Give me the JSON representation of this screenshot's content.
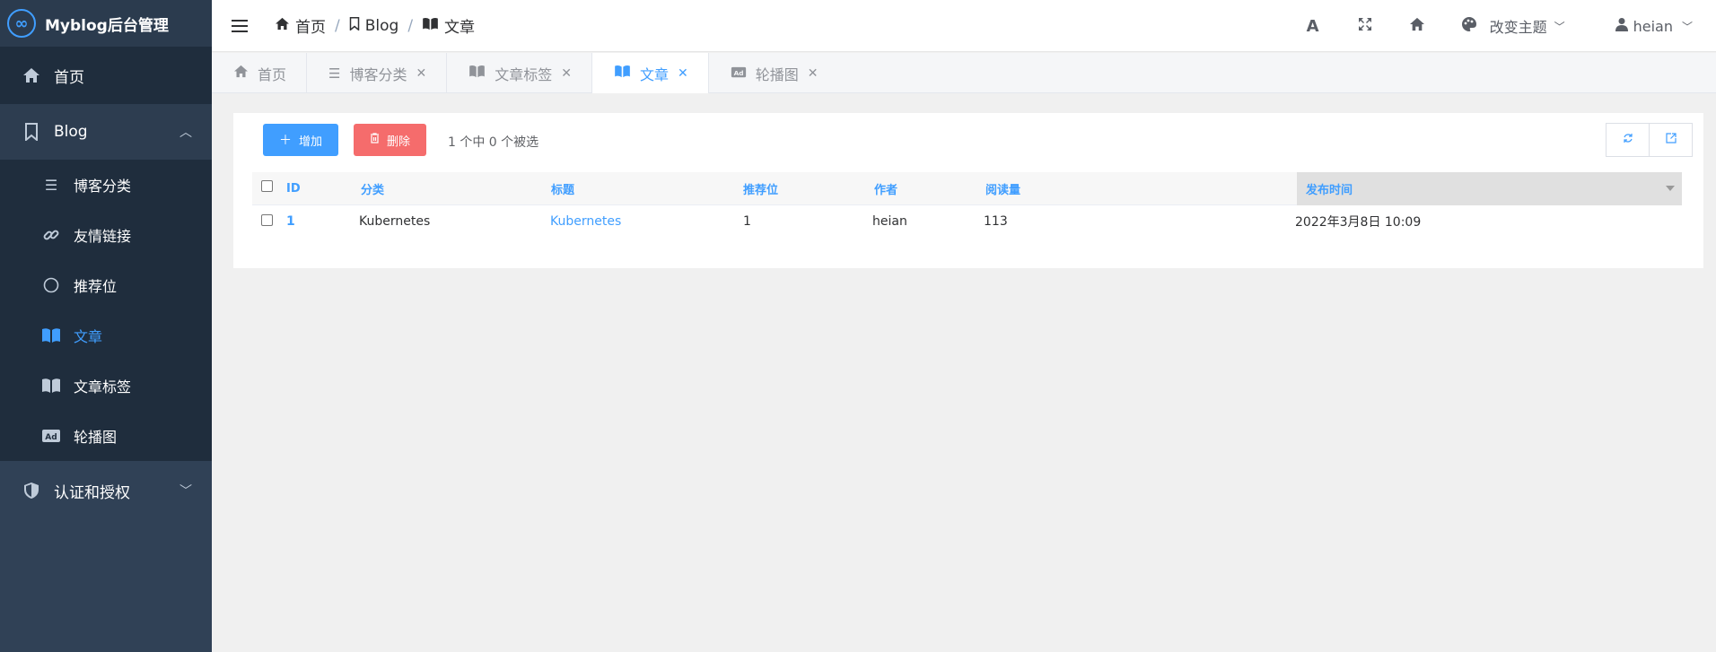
{
  "brand": {
    "logo": "∞",
    "title": "Myblog后台管理"
  },
  "sidebar": {
    "home": {
      "label": "首页",
      "icon": "home-icon"
    },
    "blog_group": {
      "label": "Blog",
      "icon": "bookmark-icon",
      "chevron": "︿"
    },
    "blog_items": [
      {
        "label": "博客分类",
        "icon": "list-icon",
        "glyph": "☰"
      },
      {
        "label": "友情链接",
        "icon": "link-icon",
        "glyph": "🔗"
      },
      {
        "label": "推荐位",
        "icon": "circle-icon",
        "glyph": "○"
      },
      {
        "label": "文章",
        "icon": "book-open-icon",
        "glyph": "📖",
        "active": true
      },
      {
        "label": "文章标签",
        "icon": "book-icon",
        "glyph": "📖"
      },
      {
        "label": "轮播图",
        "icon": "ad-icon",
        "glyph": "Ad"
      }
    ],
    "auth_group": {
      "label": "认证和授权",
      "icon": "shield-icon",
      "chevron": "﹀"
    }
  },
  "header": {
    "breadcrumb": [
      {
        "label": "首页",
        "icon": "home-icon"
      },
      {
        "label": "Blog",
        "icon": "bookmark-icon"
      },
      {
        "label": "文章",
        "icon": "book-open-icon"
      }
    ],
    "theme_label": "改变主题",
    "user_name": "heian"
  },
  "tabs": [
    {
      "label": "首页",
      "icon": "home-icon",
      "closable": false
    },
    {
      "label": "博客分类",
      "icon": "list-icon",
      "closable": true
    },
    {
      "label": "文章标签",
      "icon": "book-icon",
      "closable": true
    },
    {
      "label": "文章",
      "icon": "book-open-icon",
      "closable": true,
      "active": true
    },
    {
      "label": "轮播图",
      "icon": "ad-icon",
      "closable": true
    }
  ],
  "toolbar": {
    "add_label": "增加",
    "delete_label": "删除",
    "selection_info": "1 个中 0 个被选"
  },
  "table": {
    "columns": [
      "ID",
      "分类",
      "标题",
      "推荐位",
      "作者",
      "阅读量",
      "发布时间"
    ],
    "rows": [
      {
        "id": "1",
        "category": "Kubernetes",
        "title": "Kubernetes",
        "position": "1",
        "author": "heian",
        "views": "113",
        "published": "2022年3月8日 10:09"
      }
    ]
  },
  "colors": {
    "primary": "#409eff",
    "danger": "#f56c6c",
    "sidebar": "#304156"
  }
}
